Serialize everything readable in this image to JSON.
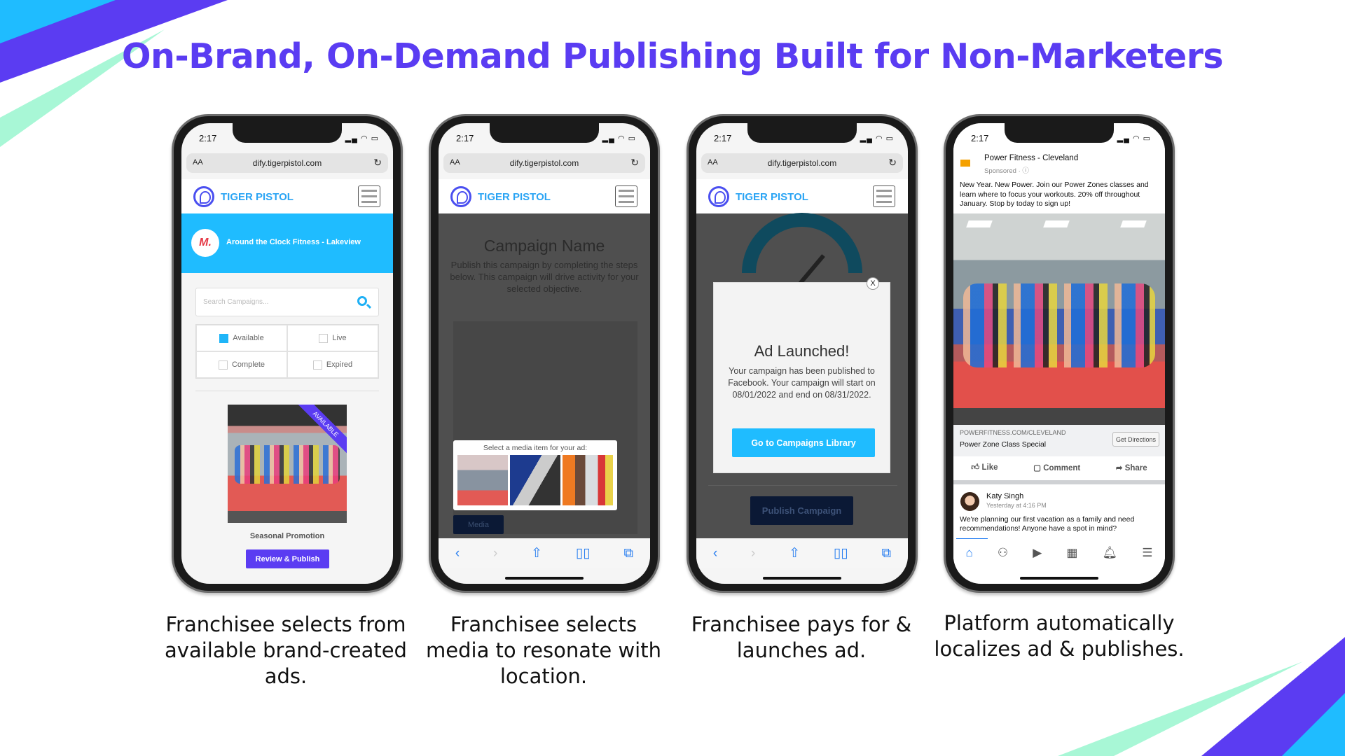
{
  "title": "On-Brand, On-Demand Publishing Built for Non-Marketers",
  "colors": {
    "title": "#5a3cf2",
    "accent_blue": "#1fbcff",
    "purple": "#5b3cf2",
    "navy": "#0b1935",
    "mint": "#a8f7d6"
  },
  "status_bar": {
    "time": "2:17",
    "icons": "signal wifi battery"
  },
  "browser": {
    "text_size": "AA",
    "address": "dify.tigerpistol.com",
    "reload_icon": "reload-icon"
  },
  "brand": {
    "name": "TIGER PISTOL",
    "menu_icon": "hamburger-icon"
  },
  "phone1": {
    "location": "Around the Clock Fitness - Lakeview",
    "search_placeholder": "Search Campaigns...",
    "filters": [
      {
        "label": "Available",
        "checked": true
      },
      {
        "label": "Live",
        "checked": false
      },
      {
        "label": "Complete",
        "checked": false
      },
      {
        "label": "Expired",
        "checked": false
      }
    ],
    "ribbon": "AVAILABLE",
    "campaign_title": "Seasonal Promotion",
    "button": "Review & Publish"
  },
  "phone2": {
    "campaign_name": "Campaign Name",
    "description": "Publish this campaign by completing the steps below. This campaign will drive activity for your selected objective.",
    "media_prompt": "Select a media item for your ad:",
    "media_button": "Media"
  },
  "phone3": {
    "close": "X",
    "modal_title": "Ad Launched!",
    "modal_body": "Your campaign has been published to Facebook. Your campaign will start on 08/01/2022 and end on 08/31/2022.",
    "modal_button": "Go to Campaigns Library",
    "publish_button": "Publish Campaign"
  },
  "phone4": {
    "page_name": "Power Fitness - Cleveland",
    "sponsored": "Sponsored · ⓘ",
    "ad_text": "New Year. New Power. Join our Power Zones classes and learn where to focus your workouts. 20% off throughout January. Stop by today to sign up!",
    "link_url": "POWERFITNESS.COM/CLEVELAND",
    "link_title": "Power Zone Class Special",
    "cta": "Get Directions",
    "actions": [
      "Like",
      "Comment",
      "Share"
    ],
    "post_author": "Katy Singh",
    "post_time": "Yesterday at 4:16 PM",
    "post_text": "We're planning our first vacation as a family and need recommendations! Anyone have a spot in mind?"
  },
  "captions": [
    "Franchisee selects from available brand-created ads.",
    "Franchisee selects media to resonate with location.",
    "Franchisee pays for & launches ad.",
    "Platform automatically localizes ad & publishes."
  ]
}
